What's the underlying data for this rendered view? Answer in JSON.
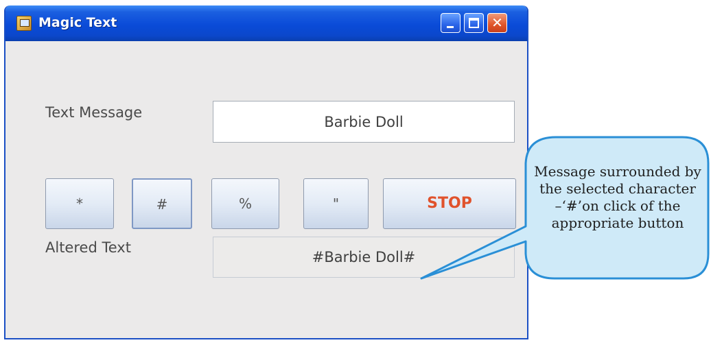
{
  "window": {
    "title": "Magic Text"
  },
  "form": {
    "text_message_label": "Text Message",
    "text_message_value": "Barbie Doll",
    "altered_text_label": "Altered Text",
    "altered_text_value": "#Barbie Doll#"
  },
  "buttons": {
    "star": "*",
    "hash": "#",
    "percent": "%",
    "quote": "\"",
    "stop": "STOP"
  },
  "callout": {
    "text": "Message surrounded by the selected character –‘#’on click of the appropriate button"
  },
  "colors": {
    "title_bar": "#0a4bd8",
    "stop_text": "#e0522c",
    "callout_fill": "#cfeaf8",
    "callout_border": "#2a8fd6"
  }
}
